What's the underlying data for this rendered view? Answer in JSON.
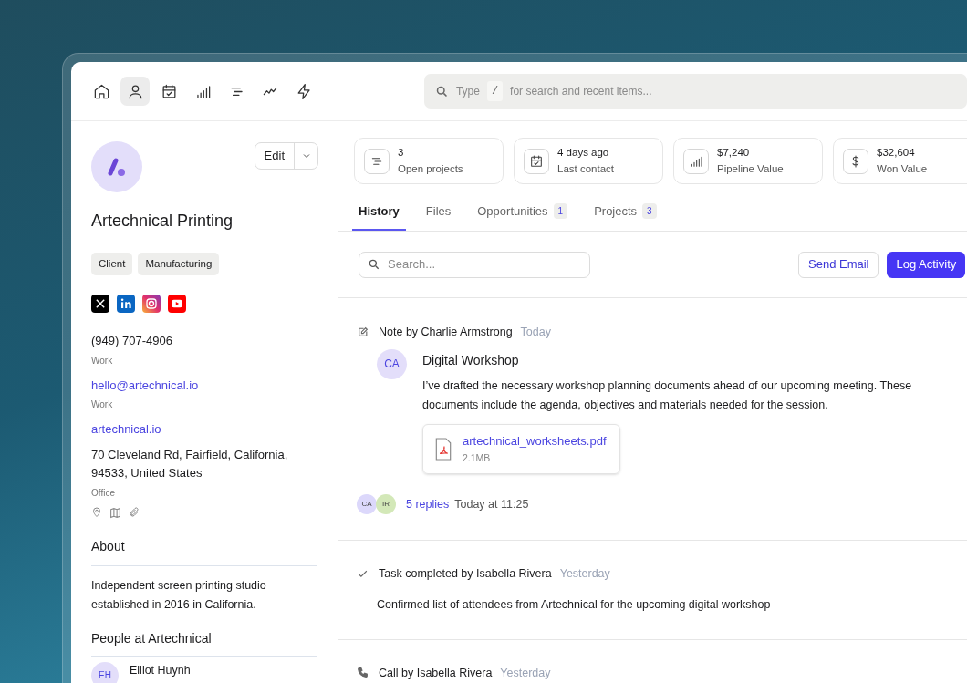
{
  "nav": {
    "items": [
      {
        "selected": false
      },
      {
        "selected": true
      },
      {
        "selected": false
      },
      {
        "selected": false
      },
      {
        "selected": false
      },
      {
        "selected": false
      },
      {
        "selected": false
      }
    ],
    "search": {
      "placeholder_before": "Type",
      "key": "/",
      "placeholder_after": "for search and recent items..."
    }
  },
  "company": {
    "name": "Artechnical Printing",
    "edit_label": "Edit",
    "tags": [
      "Client",
      "Manufacturing"
    ],
    "socials": [
      {
        "kind": "x"
      },
      {
        "kind": "linkedin"
      },
      {
        "kind": "instagram"
      },
      {
        "kind": "youtube"
      }
    ],
    "phone": {
      "value": "(949) 707-4906",
      "label": "Work"
    },
    "email": {
      "value": "hello@artechnical.io",
      "label": "Work"
    },
    "website": "artechnical.io",
    "address": {
      "value": "70 Cleveland Rd, Fairfield, California, 94533, United States",
      "label": "Office"
    },
    "about": {
      "title": "About",
      "text": "Independent screen printing studio established in 2016 in California."
    },
    "people": {
      "title": "People at Artechnical",
      "items": [
        {
          "initials": "EH",
          "name": "Elliot Huynh"
        }
      ]
    }
  },
  "stats": [
    {
      "value": "3",
      "label": "Open projects"
    },
    {
      "value": "4 days ago",
      "label": "Last contact"
    },
    {
      "value": "$7,240",
      "label": "Pipeline Value"
    },
    {
      "value": "$32,604",
      "label": "Won Value"
    }
  ],
  "tabs": [
    {
      "label": "History",
      "selected": true
    },
    {
      "label": "Files",
      "selected": false
    },
    {
      "label": "Opportunities",
      "count": "1",
      "selected": false
    },
    {
      "label": "Projects",
      "count": "3",
      "selected": false
    }
  ],
  "toolbar": {
    "search_placeholder": "Search...",
    "buttons": [
      {
        "label": "Send Email",
        "primary": false
      },
      {
        "label": "Log Activity",
        "primary": true
      }
    ]
  },
  "activities": [
    {
      "kind": "note",
      "title": "Note by Charlie Armstrong",
      "time": "Today",
      "author_initials": "CA",
      "heading": "Digital Workshop",
      "body": "I’ve drafted the necessary workshop planning documents ahead of our upcoming meeting. These documents include the agenda, objectives and materials needed for the session.",
      "attachment": {
        "name": "artechnical_worksheets.pdf",
        "size": "2.1MB"
      },
      "reply_avatars": [
        {
          "initials": "CA",
          "color": "#dcd8fb"
        },
        {
          "initials": "IR",
          "color": "#d3e8b8"
        }
      ],
      "replies": "5 replies",
      "reply_time": "Today at 11:25"
    },
    {
      "kind": "task",
      "title": "Task completed by Isabella Rivera",
      "time": "Yesterday",
      "body": "Confirmed list of attendees from Artechnical for the upcoming digital workshop"
    },
    {
      "kind": "call",
      "title": "Call by Isabella Rivera",
      "time": "Yesterday"
    }
  ]
}
